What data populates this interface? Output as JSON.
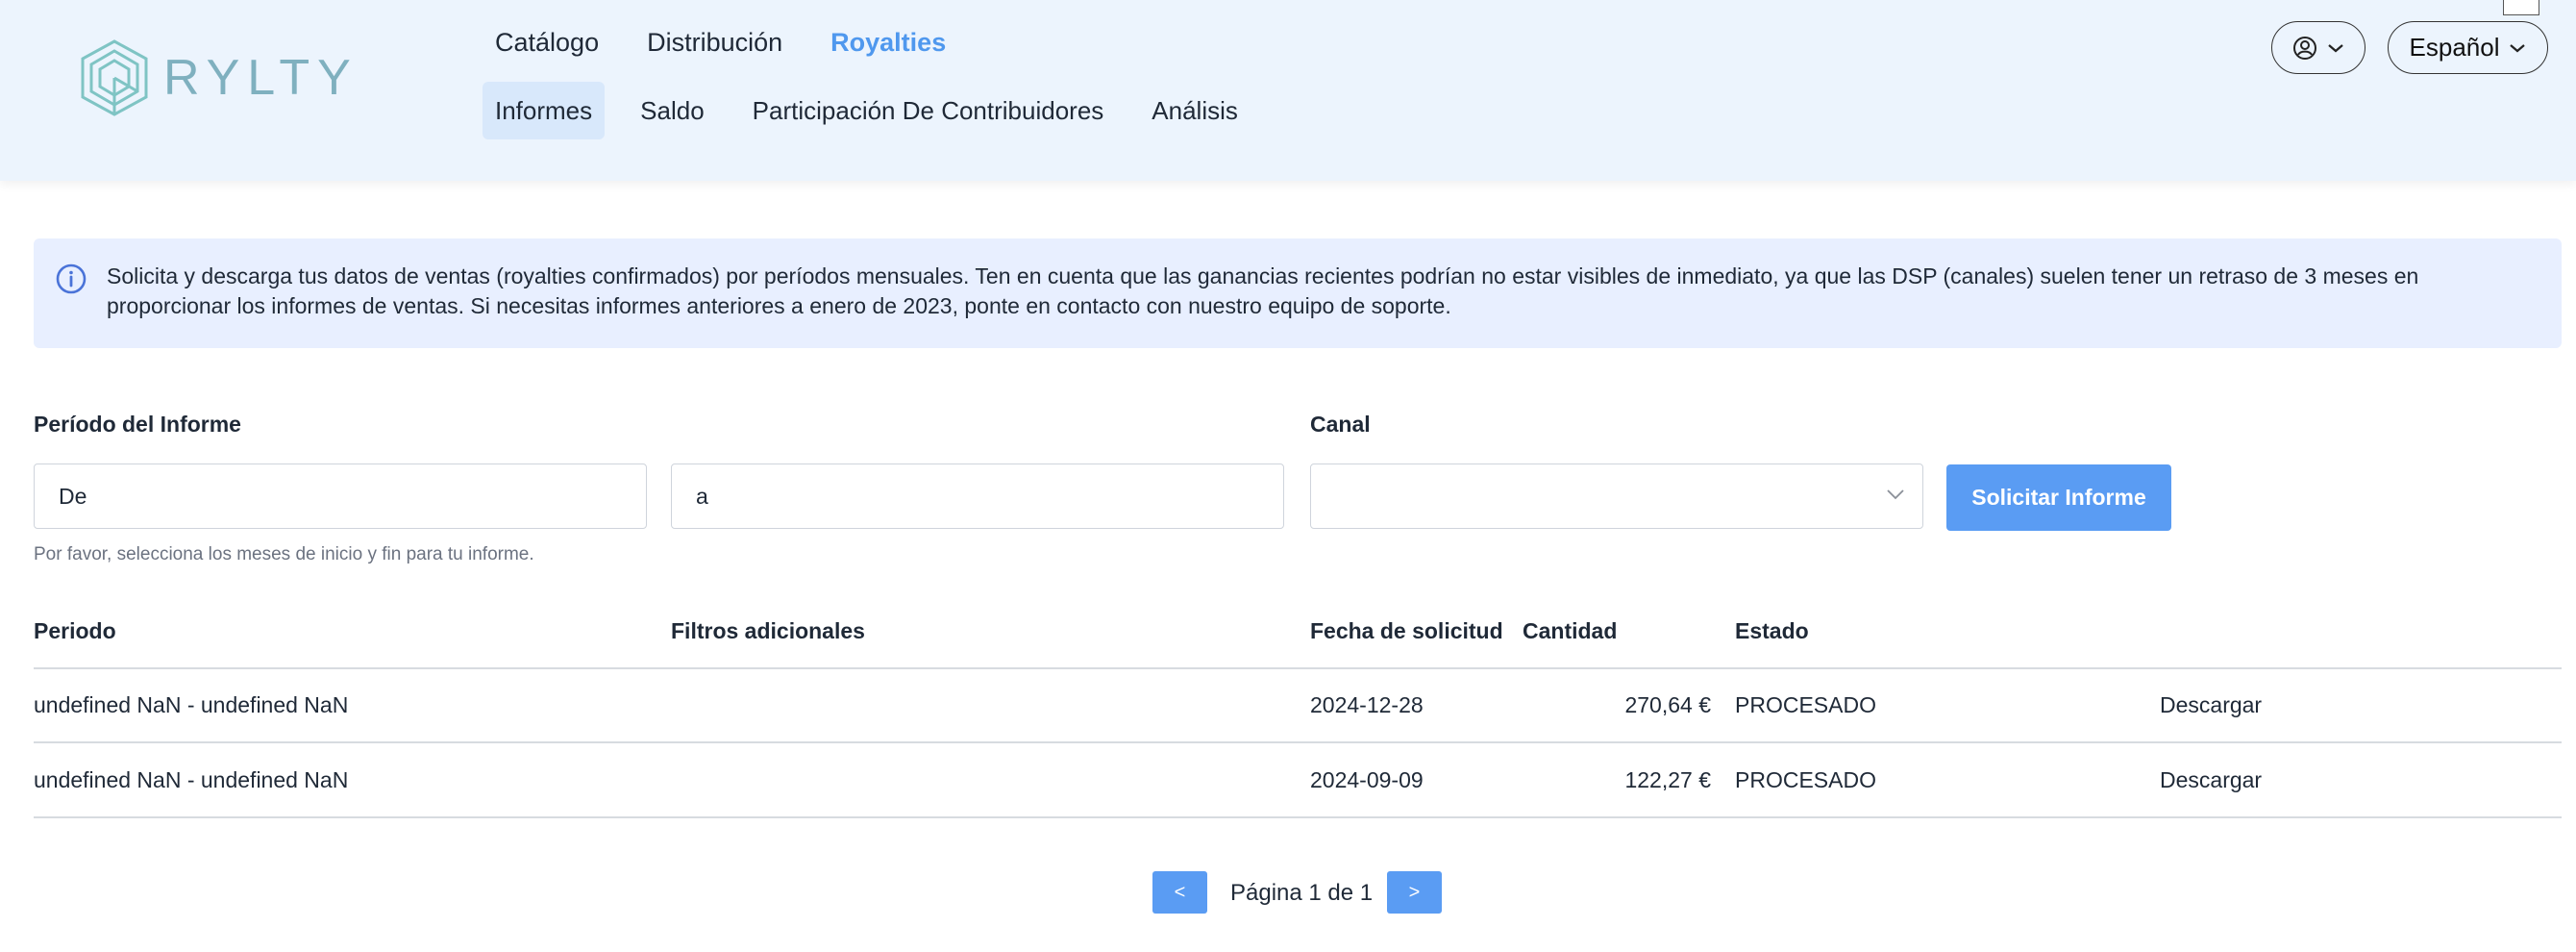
{
  "brand": {
    "name": "RYLTY"
  },
  "nav": {
    "main": [
      "Catálogo",
      "Distribución",
      "Royalties"
    ],
    "sub": [
      "Informes",
      "Saldo",
      "Participación De Contribuidores",
      "Análisis"
    ]
  },
  "header": {
    "language": "Español"
  },
  "info": {
    "text": "Solicita y descarga tus datos de ventas (royalties confirmados) por períodos mensuales. Ten en cuenta que las ganancias recientes podrían no estar visibles de inmediato, ya que las DSP (canales) suelen tener un retraso de 3 meses en proporcionar los informes de ventas. Si necesitas informes anteriores a enero de 2023, ponte en contacto con nuestro equipo de soporte."
  },
  "form": {
    "period_label": "Período del Informe",
    "from_placeholder": "De",
    "to_placeholder": "a",
    "channel_label": "Canal",
    "channel_value": "",
    "submit": "Solicitar Informe",
    "hint": "Por favor, selecciona los meses de inicio y fin para tu informe."
  },
  "table": {
    "headers": [
      "Periodo",
      "Filtros adicionales",
      "Fecha de solicitud",
      "Cantidad",
      "Estado"
    ],
    "rows": [
      {
        "period": "undefined NaN - undefined NaN",
        "filters": "",
        "date": "2024-12-28",
        "amount": "270,64 €",
        "status": "PROCESADO",
        "action": "Descargar"
      },
      {
        "period": "undefined NaN - undefined NaN",
        "filters": "",
        "date": "2024-09-09",
        "amount": "122,27 €",
        "status": "PROCESADO",
        "action": "Descargar"
      }
    ]
  },
  "pagination": {
    "prev": "<",
    "next": ">",
    "label": "Página 1 de 1"
  },
  "colors": {
    "accent": "#4f98ee",
    "button": "#5a9cf3",
    "header_bg": "#ecf4fd",
    "info_bg": "#e8efff"
  }
}
